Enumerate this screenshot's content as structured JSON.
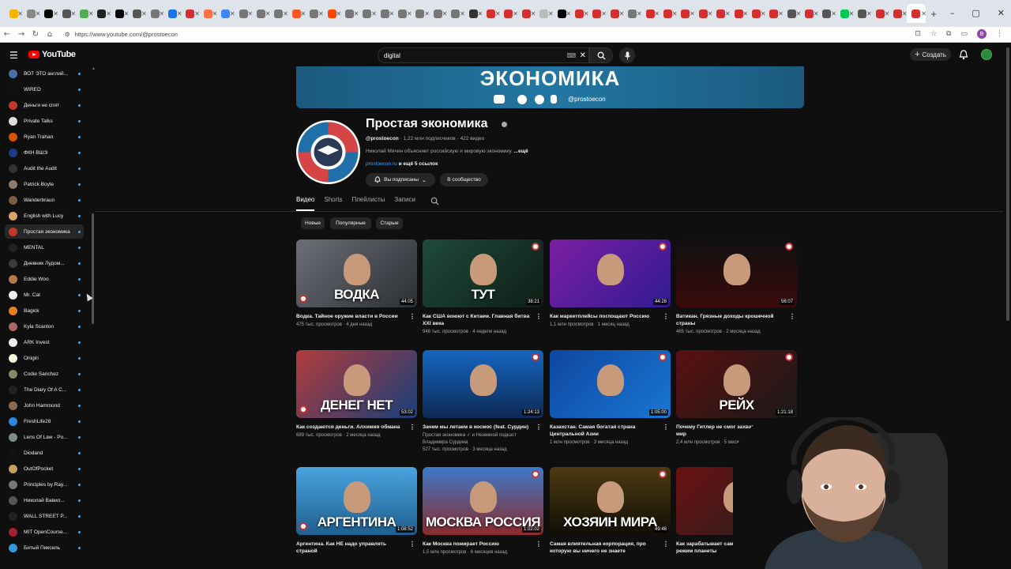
{
  "browser": {
    "url": "https://www.youtube.com/@prostoecon",
    "tab_count": 52,
    "favicon_colors": [
      "#f4b400",
      "#888",
      "#000",
      "#555",
      "#4caf50",
      "#222",
      "#000",
      "#555",
      "#777",
      "#1a73e8",
      "#d32f2f",
      "#ff7043",
      "#4285f4",
      "#777",
      "#777",
      "#777",
      "#ff5722",
      "#777",
      "#ff4500",
      "#777",
      "#777",
      "#777",
      "#777",
      "#777",
      "#777",
      "#777",
      "#333",
      "#d32f2f",
      "#d32f2f",
      "#d32f2f",
      "#bbb",
      "#000",
      "#d32f2f",
      "#d32f2f",
      "#d32f2f",
      "#777",
      "#d32f2f",
      "#d32f2f",
      "#d32f2f",
      "#d32f2f",
      "#d32f2f",
      "#d32f2f",
      "#d32f2f",
      "#d32f2f",
      "#555",
      "#d32f2f",
      "#555",
      "#00c853",
      "#555",
      "#d32f2f",
      "#d32f2f",
      "#d32f2f"
    ],
    "new_tab_symbol": "+",
    "window_controls": [
      "–",
      "▢",
      "✕"
    ]
  },
  "header": {
    "logo_text": "YouTube",
    "search_value": "digital",
    "create_label": "Создать",
    "create_icon": "+"
  },
  "sidebar": {
    "items": [
      {
        "label": "ВОТ ЭТО англий...",
        "color": "#4a6fa5"
      },
      {
        "label": "WIRED",
        "color": "#111"
      },
      {
        "label": "Деньги не спят",
        "color": "#c0392b"
      },
      {
        "label": "Private Talks",
        "color": "#ddd"
      },
      {
        "label": "Ryan Trahan",
        "color": "#d35400"
      },
      {
        "label": "ФКН ВШЭ",
        "color": "#1e3a8a"
      },
      {
        "label": "Audit the Audit",
        "color": "#333"
      },
      {
        "label": "Patrick Boyle",
        "color": "#8e7b6b"
      },
      {
        "label": "Wanderbraun",
        "color": "#7a5c3e"
      },
      {
        "label": "English with Lucy",
        "color": "#d9a36c"
      },
      {
        "label": "Простая экономика",
        "color": "#c0392b",
        "active": true
      },
      {
        "label": "MENTAL",
        "color": "#222"
      },
      {
        "label": "Дневник Лудом...",
        "color": "#3b3b3b"
      },
      {
        "label": "Eddie Woo",
        "color": "#b37a4c"
      },
      {
        "label": "Mr. Cat",
        "color": "#eee"
      },
      {
        "label": "Bagick",
        "color": "#e67e22"
      },
      {
        "label": "Kyla Scanlon",
        "color": "#a66"
      },
      {
        "label": "ARK Invest",
        "color": "#eee"
      },
      {
        "label": "Onigiri",
        "color": "#f5f5dc"
      },
      {
        "label": "Codie Sanchez",
        "color": "#886"
      },
      {
        "label": "The Diary Of A C...",
        "color": "#222"
      },
      {
        "label": "John Hammond",
        "color": "#8a6a50"
      },
      {
        "label": "FreshLife28",
        "color": "#2e86de"
      },
      {
        "label": "Lens Of Law - Po...",
        "color": "#7f8c8d"
      },
      {
        "label": "Diodand",
        "color": "#111"
      },
      {
        "label": "OutOfPocket",
        "color": "#c0a060"
      },
      {
        "label": "Principles by Ray...",
        "color": "#777"
      },
      {
        "label": "Николай Вавил...",
        "color": "#555"
      },
      {
        "label": "WALL STREET P...",
        "color": "#222"
      },
      {
        "label": "MIT OpenCourse...",
        "color": "#a31f34"
      },
      {
        "label": "Битый Пиксель",
        "color": "#3498db"
      }
    ]
  },
  "banner": {
    "title": "ЭКОНОМИКА",
    "handle": "@prostoecon"
  },
  "channel": {
    "name": "Простая экономика",
    "handle": "@prostoecon",
    "subscribers": "1,22 млн подписчиков",
    "video_count": "422 видео",
    "separator": "·",
    "description": "Николай Мячин объясняет российскую и мировую экономику.",
    "description_more": "...ещё",
    "link": "prostoecon.ru",
    "more_links": "и ещё 5 ссылок",
    "subscribed_label": "Вы подписаны",
    "community_label": "В сообщество"
  },
  "tabs": [
    "Видео",
    "Shorts",
    "Плейлисты",
    "Записи"
  ],
  "chips": [
    "Новые",
    "Популярные",
    "Старые"
  ],
  "videos": [
    {
      "title": "Водка. Тайное оружие власти в России",
      "meta1": "475 тыс. просмотров · 4 дня назад",
      "meta2": "",
      "meta3": "",
      "duration": "44:05",
      "big": "ВОДКА",
      "bg": "linear-gradient(135deg,#6b6f75,#2c2f33)"
    },
    {
      "title": "Как США воюют с Китаем. Главная битва XXI века",
      "meta1": "948 тыс. просмотров · 4 недели назад",
      "meta2": "",
      "meta3": "",
      "duration": "38:21",
      "big": "ТУТ",
      "bg": "linear-gradient(135deg,#1e4b3a,#0e1e16)"
    },
    {
      "title": "Как маркетплейсы поглощают Россию",
      "meta1": "1,1 млн просмотров · 1 месяц назад",
      "meta2": "",
      "meta3": "",
      "duration": "44:28",
      "big": "",
      "bg": "linear-gradient(135deg,#7b1fa2,#311b92)"
    },
    {
      "title": "Ватикан. Грязные доходы крошечной страны",
      "meta1": "465 тыс. просмотров · 2 месяца назад",
      "meta2": "",
      "meta3": "",
      "duration": "56:07",
      "big": "",
      "bg": "linear-gradient(180deg,#111,#3a0a0a)"
    },
    {
      "title": "Как создаются деньги. Алхимия обмана",
      "meta1": "689 тыс. просмотров · 2 месяца назад",
      "meta2": "",
      "meta3": "",
      "duration": "53:02",
      "big": "ДЕНЕГ НЕТ",
      "bg": "linear-gradient(135deg,#b23b3b,#1a3f7a)"
    },
    {
      "title": "Зачем мы летаем в космос (feat. Сурдин)",
      "meta1": "Простая экономика ✓ и Неземной подкаст",
      "meta2": "Владимира Сурдина",
      "meta3": "527 тыс. просмотров · 3 месяца назад",
      "duration": "1:24:13",
      "big": "",
      "bg": "linear-gradient(180deg,#1565c0,#0d2a55)"
    },
    {
      "title": "Казахстан. Самая богатая страна Центральной Азии",
      "meta1": "1 млн просмотров · 3 месяца назад",
      "meta2": "",
      "meta3": "",
      "duration": "1:05:00",
      "big": "",
      "bg": "linear-gradient(135deg,#0d47a1,#1976d2)"
    },
    {
      "title": "Почему Гитлер не смог захватить весь мир",
      "meta1": "2,4 млн просмотров · 5 месяцев назад",
      "meta2": "",
      "meta3": "",
      "duration": "1:21:18",
      "big": "РЕЙХ",
      "bg": "linear-gradient(135deg,#5a1010,#1a1a1a)"
    },
    {
      "title": "Аргентина. Как НЕ надо управлять страной",
      "meta1": "",
      "meta2": "",
      "meta3": "",
      "duration": "1:08:52",
      "big": "АРГЕНТИНА",
      "bg": "linear-gradient(180deg,#4aa3df,#1f5f8f)"
    },
    {
      "title": "Как Москва пожирает Россию",
      "meta1": "1,5 млн просмотров · 6 месяцев назад",
      "meta2": "",
      "meta3": "",
      "duration": "1:02:02",
      "big": "МОСКВА РОССИЯ",
      "bg": "linear-gradient(180deg,#3b79c9,#8a2b2b)"
    },
    {
      "title": "Самая влиятельная корпорация, про которую вы ничего не знаете",
      "meta1": "",
      "meta2": "",
      "meta3": "",
      "duration": "49:48",
      "big": "ХОЗЯИН МИРА",
      "bg": "linear-gradient(180deg,#4c3b12,#120e05)"
    },
    {
      "title": "Как зарабатывает самый закрытый режим планеты",
      "meta1": "",
      "meta2": "",
      "meta3": "",
      "duration": "",
      "big": "",
      "bg": "linear-gradient(135deg,#6b1010,#222)"
    }
  ],
  "more_label": "⋮"
}
